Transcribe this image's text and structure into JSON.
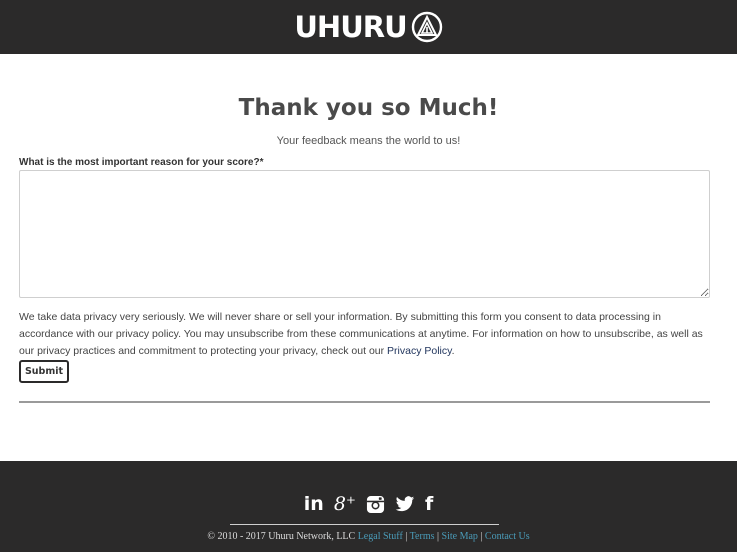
{
  "header": {
    "logo_text": "UHURU",
    "logo_icon": "uhuru-emblem-icon"
  },
  "main": {
    "title": "Thank you so Much!",
    "subtitle": "Your feedback means the world to us!",
    "question_label": "What is the most important reason for your score?*",
    "answer_value": "",
    "privacy_text": "We take data privacy very seriously. We will never share or sell your information. By submitting this form you consent to data processing in accordance with our privacy policy. You may unsubscribe from these communications at anytime. For information on how to unsubscribe, as well as our privacy practices and commitment to protecting your privacy, check out our ",
    "privacy_link": "Privacy Policy",
    "privacy_end": ".",
    "submit_label": "Submit"
  },
  "footer": {
    "social": [
      {
        "icon": "linkedin-icon",
        "glyph": "in"
      },
      {
        "icon": "google-plus-icon",
        "glyph": "8⁺"
      },
      {
        "icon": "instagram-icon",
        "glyph": ""
      },
      {
        "icon": "twitter-icon",
        "glyph": ""
      },
      {
        "icon": "facebook-icon",
        "glyph": "f"
      }
    ],
    "copyright": "© 2010 - 2017 Uhuru Network, LLC",
    "links": [
      "Legal Stuff",
      "Terms",
      "Site Map",
      "Contact Us"
    ],
    "separator": "|"
  },
  "colors": {
    "header_bg": "#2b2a2a",
    "footer_link": "#4a9bb8",
    "privacy_link": "#22365e"
  }
}
